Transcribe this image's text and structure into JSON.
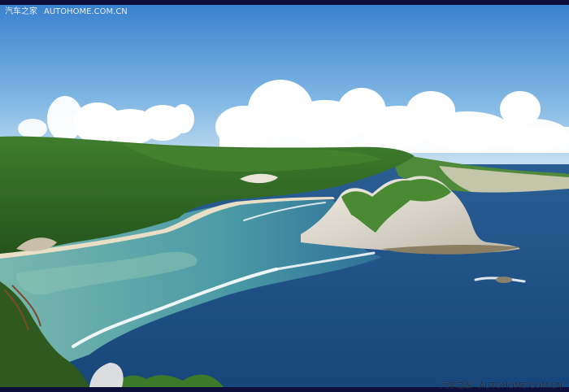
{
  "watermark_top": {
    "cn": "汽车之家",
    "en": "AUTOHOME.COM.CN"
  },
  "watermark_bottom": {
    "cn": "汽车之家",
    "en": "AUTOHOME.COM.CN"
  },
  "colors": {
    "frame": "#0b0f3a",
    "sky_top": "#3d86d2",
    "sky_bottom": "#cde3f3",
    "ocean_deep": "#1c4f86",
    "lagoon": "#4fa4a8",
    "vegetation": "#2f6b24",
    "cliff": "#e9e4d8"
  }
}
